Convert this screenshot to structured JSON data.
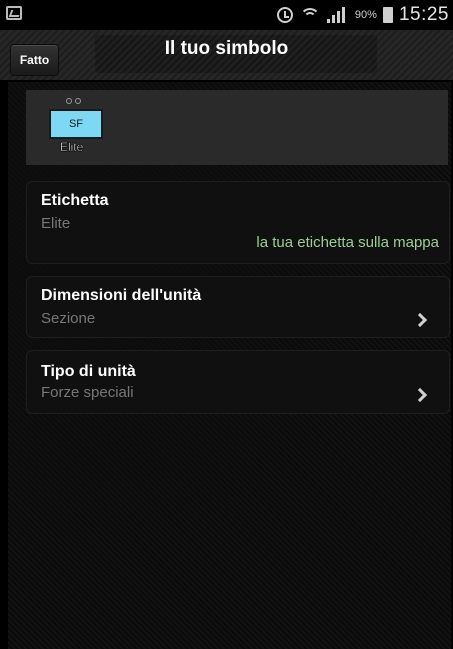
{
  "status_bar": {
    "battery_percent": "90%",
    "time": "15:25",
    "icons": [
      "gallery-icon",
      "alarm-icon",
      "wifi-icon",
      "signal-icon",
      "battery-icon"
    ]
  },
  "header": {
    "done_label": "Fatto",
    "title": "Il tuo simbolo"
  },
  "symbol": {
    "code": "SF",
    "label": "Elite",
    "fill_color": "#7dd8f3"
  },
  "fields": [
    {
      "title": "Etichetta",
      "value": "Elite",
      "hint": "la tua etichetta sulla mappa"
    },
    {
      "title": "Dimensioni dell'unità",
      "value": "Sezione"
    },
    {
      "title": "Tipo di unità",
      "value": "Forze speciali"
    }
  ]
}
